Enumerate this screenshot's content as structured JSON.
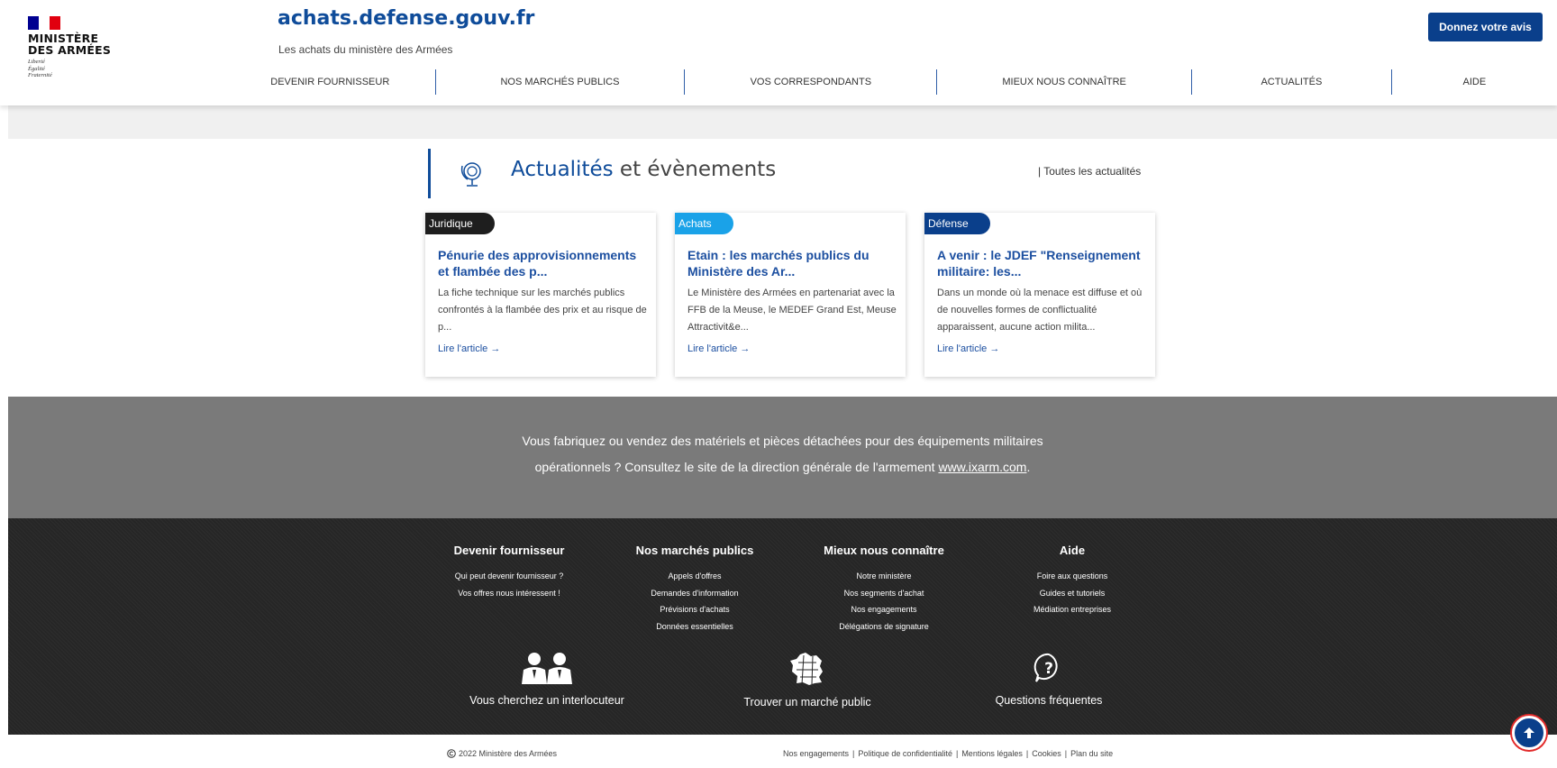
{
  "header": {
    "logo_name": "MINISTÈRE\nDES ARMÉES",
    "logo_line1": "MINISTÈRE",
    "logo_line2": "DES ARMÉES",
    "motto": [
      "Liberté",
      "Égalité",
      "Fraternité"
    ],
    "site_title": "achats.defense.gouv.fr",
    "site_subtitle": "Les achats du ministère des Armées",
    "feedback_button": "Donnez votre avis",
    "nav": [
      "DEVENIR FOURNISSEUR",
      "NOS MARCHÉS PUBLICS",
      "VOS CORRESPONDANTS",
      "MIEUX NOUS CONNAÎTRE",
      "ACTUALITÉS",
      "AIDE"
    ]
  },
  "news": {
    "title_highlight": "Actualités",
    "title_rest": " et évènements",
    "all_link": "| Toutes les actualités",
    "cards": [
      {
        "tag": "Juridique",
        "tag_color": "#1e1e1e",
        "title": "Pénurie des approvisionnements et flambée des p...",
        "body": "La fiche technique sur les marchés publics confrontés à la flambée des prix et au risque de p...",
        "link": "Lire l'article →"
      },
      {
        "tag": "Achats",
        "tag_color": "#1aa2e8",
        "title": "Etain : les marchés publics du Ministère des Ar...",
        "body": "Le Ministère des Armées en partenariat avec la FFB de la Meuse, le MEDEF Grand Est, Meuse Attractivit&e...",
        "link": "Lire l'article →"
      },
      {
        "tag": "Défense",
        "tag_color": "#0a3f8b",
        "title": "A venir : le JDEF \"Renseignement militaire: les...",
        "body": "Dans un monde où la menace est diffuse et où de nouvelles formes de conflictualité apparaissent, aucune action milita...",
        "link": "Lire l'article →"
      }
    ]
  },
  "promo": {
    "line1": "Vous fabriquez ou vendez des matériels et pièces détachées pour des équipements militaires",
    "line2_text": "opérationnels ? Consultez le site de la direction générale de l'armement ",
    "line2_link": "www.ixarm.com",
    "line2_end": "."
  },
  "footer": {
    "columns": [
      {
        "heading": "Devenir fournisseur",
        "links": [
          "Qui peut devenir fournisseur ?",
          "Vos offres nous intéressent !"
        ]
      },
      {
        "heading": "Nos marchés publics",
        "links": [
          "Appels d'offres",
          "Demandes d'information",
          "Prévisions d'achats",
          "Données essentielles"
        ]
      },
      {
        "heading": "Mieux nous connaître",
        "links": [
          "Notre ministère",
          "Nos segments d'achat",
          "Nos engagements",
          "Délégations de signature"
        ]
      },
      {
        "heading": "Aide",
        "links": [
          "Foire aux questions",
          "Guides et tutoriels",
          "Médiation entreprises"
        ]
      }
    ],
    "shortcuts": [
      "Vous cherchez un interlocuteur",
      "Trouver un marché public",
      "Questions fréquentes"
    ]
  },
  "bottom": {
    "copyright": "2022 Ministère des Armées",
    "legal_links": [
      "Nos engagements",
      "Politique de confidentialité",
      "Mentions légales",
      "Cookies",
      "Plan du site"
    ]
  },
  "colors": {
    "brand_blue": "#0f4c9a",
    "button_blue": "#0a3f8b",
    "flag_blue": "#000091",
    "flag_red": "#e1000f"
  }
}
